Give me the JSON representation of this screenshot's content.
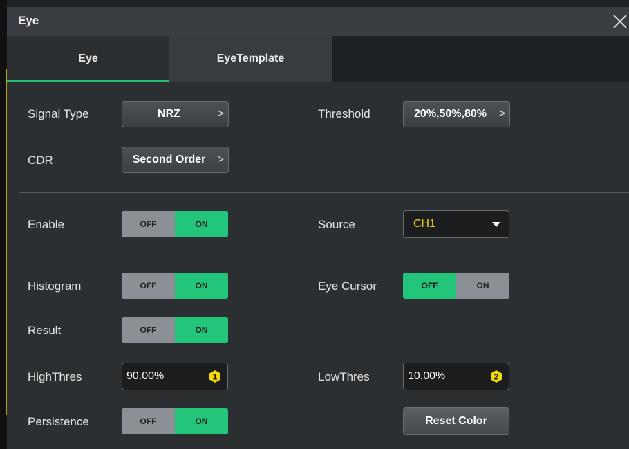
{
  "dialog": {
    "title": "Eye",
    "close_icon": "close-icon"
  },
  "tabs": [
    {
      "label": "Eye",
      "active": true
    },
    {
      "label": "EyeTemplate",
      "active": false
    }
  ],
  "settings": {
    "signal_type": {
      "label": "Signal Type",
      "value": "NRZ",
      "chevron": ">"
    },
    "threshold": {
      "label": "Threshold",
      "value": "20%,50%,80%",
      "chevron": ">"
    },
    "cdr": {
      "label": "CDR",
      "value": "Second Order",
      "chevron": ">"
    },
    "enable": {
      "label": "Enable",
      "off": "OFF",
      "on": "ON",
      "state": "on"
    },
    "source": {
      "label": "Source",
      "value": "CH1"
    },
    "histogram": {
      "label": "Histogram",
      "off": "OFF",
      "on": "ON",
      "state": "on"
    },
    "eye_cursor": {
      "label": "Eye Cursor",
      "off": "OFF",
      "on": "ON",
      "state": "off"
    },
    "result": {
      "label": "Result",
      "off": "OFF",
      "on": "ON",
      "state": "on"
    },
    "high_thres": {
      "label": "HighThres",
      "value": "90.00%",
      "badge": "1"
    },
    "low_thres": {
      "label": "LowThres",
      "value": "10.00%",
      "badge": "2"
    },
    "persistence": {
      "label": "Persistence",
      "off": "OFF",
      "on": "ON",
      "state": "on"
    },
    "reset_color": {
      "label": "Reset Color"
    }
  },
  "colors": {
    "accent_green": "#22c57a",
    "source_value": "#f0d020",
    "badge_yellow": "#f5d90a"
  }
}
